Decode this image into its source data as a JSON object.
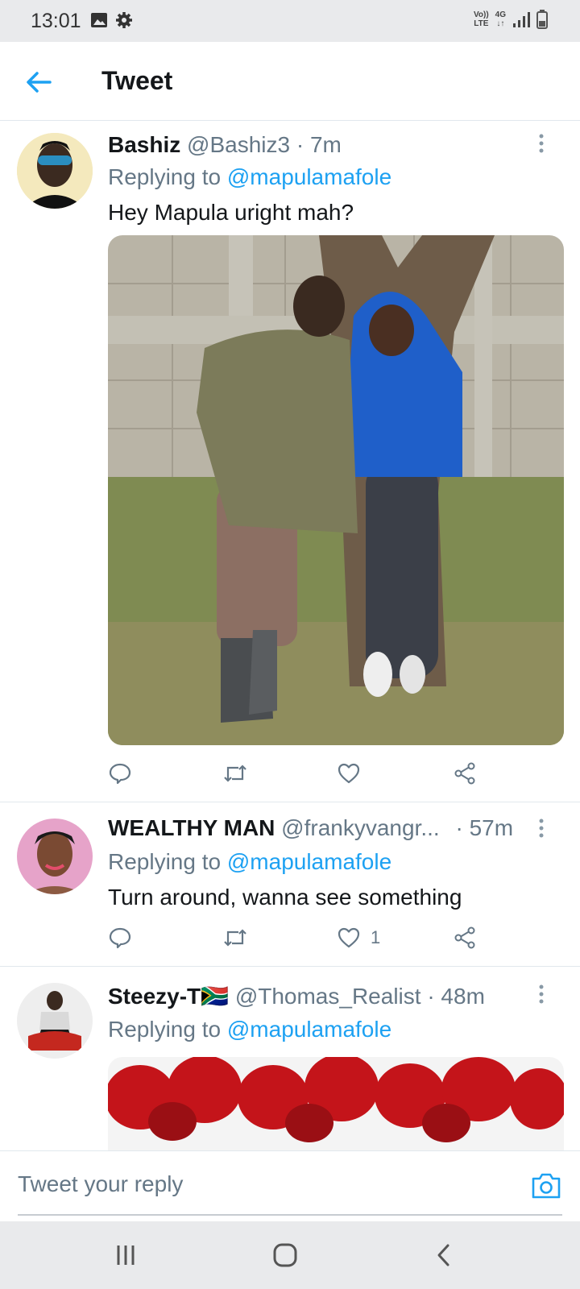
{
  "status_bar": {
    "time": "13:01",
    "lte_top": "Vo))",
    "lte_bottom": "LTE",
    "net_top": "4G",
    "net_bottom": "↓↑"
  },
  "header": {
    "title": "Tweet"
  },
  "tweets": [
    {
      "name": "Bashiz",
      "handle": "@Bashiz3",
      "time": "· 7m",
      "replying_prefix": "Replying to ",
      "mention": "@mapulamafole",
      "text": "Hey Mapula uright mah?",
      "like_count": ""
    },
    {
      "name": "WEALTHY MAN",
      "handle": "@frankyvangr...",
      "time": "· 57m",
      "replying_prefix": "Replying to ",
      "mention": "@mapulamafole",
      "text": "Turn around,  wanna see something",
      "like_count": "1"
    },
    {
      "name": "Steezy-T",
      "flag": "🇿🇦",
      "handle": "@Thomas_Realist",
      "time": "· 48m",
      "replying_prefix": "Replying to ",
      "mention": "@mapulamafole"
    }
  ],
  "reply_bar": {
    "placeholder": "Tweet your reply"
  },
  "colors": {
    "accent": "#1da1f2",
    "muted": "#657786",
    "text": "#14171a",
    "divider": "#e1e8ed"
  }
}
